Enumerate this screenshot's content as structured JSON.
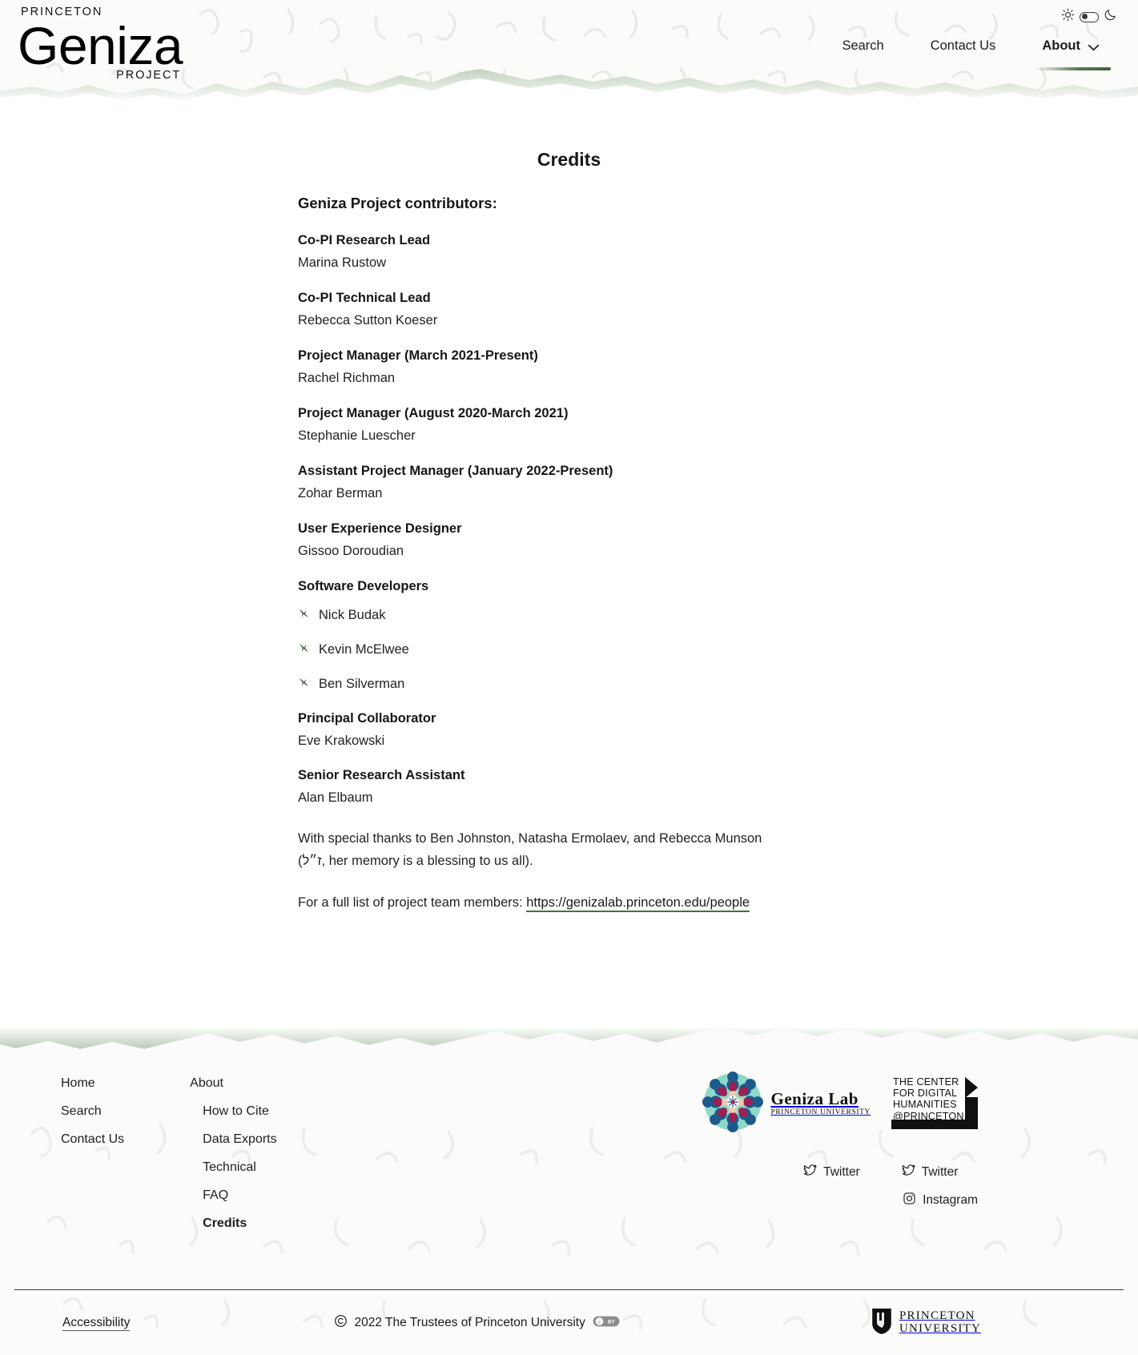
{
  "header": {
    "brand": {
      "princeton": "PRINCETON",
      "geniza": "Geniza",
      "project": "PROJECT"
    },
    "theme": {
      "sun_icon": "sun-icon",
      "moon_icon": "moon-icon",
      "switch_icon": "theme-toggle-switch"
    },
    "nav": [
      {
        "label": "Search",
        "active": false
      },
      {
        "label": "Contact Us",
        "active": false
      },
      {
        "label": "About",
        "active": true,
        "has_chevron": true
      }
    ]
  },
  "main": {
    "page_title": "Credits",
    "section_heading": "Geniza Project contributors:",
    "credits": [
      {
        "role": "Co-PI Research Lead",
        "name": "Marina Rustow"
      },
      {
        "role": "Co-PI Technical Lead",
        "name": "Rebecca Sutton Koeser"
      },
      {
        "role": "Project Manager (March 2021-Present)",
        "name": "Rachel Richman"
      },
      {
        "role": "Project Manager (August 2020-March 2021)",
        "name": "Stephanie Luescher"
      },
      {
        "role": "Assistant Project Manager (January 2022-Present)",
        "name": "Zohar Berman"
      },
      {
        "role": "User Experience Designer",
        "name": "Gissoo Doroudian"
      }
    ],
    "developers_heading": "Software Developers",
    "developers": [
      "Nick Budak",
      "Kevin McElwee",
      "Ben Silverman"
    ],
    "credits_after": [
      {
        "role": "Principal Collaborator",
        "name": "Eve Krakowski"
      },
      {
        "role": "Senior Research Assistant",
        "name": "Alan Elbaum"
      }
    ],
    "thanks_paragraph": "With special thanks to Ben Johnston, Natasha Ermolaev, and Rebecca Munson (ז״ל, her memory is a blessing to us all).",
    "full_list_prefix": "For a full list of project team members: ",
    "full_list_link": "https://genizalab.princeton.edu/people"
  },
  "footer": {
    "nav_col1": [
      {
        "label": "Home",
        "sub": false,
        "current": false
      },
      {
        "label": "Search",
        "sub": false,
        "current": false
      },
      {
        "label": "Contact Us",
        "sub": false,
        "current": false
      }
    ],
    "nav_col2": [
      {
        "label": "About",
        "sub": false,
        "current": false
      },
      {
        "label": "How to Cite",
        "sub": true,
        "current": false
      },
      {
        "label": "Data Exports",
        "sub": true,
        "current": false
      },
      {
        "label": "Technical",
        "sub": true,
        "current": false
      },
      {
        "label": "FAQ",
        "sub": true,
        "current": false
      },
      {
        "label": "Credits",
        "sub": true,
        "current": true
      }
    ],
    "geniza_lab": {
      "name": "Geniza Lab",
      "sub": "PRINCETON UNIVERSITY",
      "logo_icon": "geniza-lab-mandala-logo"
    },
    "cdh": {
      "line1": "THE CENTER",
      "line2": "FOR DIGITAL",
      "line3": "HUMANITIES",
      "line4": "@PRINCETON"
    },
    "social": [
      {
        "label": "Twitter",
        "icon": "twitter-icon"
      },
      {
        "label": "Twitter",
        "icon": "twitter-icon"
      },
      {
        "label": "Instagram",
        "icon": "instagram-icon"
      }
    ],
    "accessibility": "Accessibility",
    "copyright": "2022 The Trustees of Princeton University",
    "copyright_icon": "copyright-icon",
    "cc_badge": "cc-by-icon",
    "princeton": {
      "line1": "PRINCETON",
      "line2": "UNIVERSITY",
      "shield_icon": "princeton-shield-icon"
    }
  },
  "colors": {
    "accent_green": "#4e6b4a",
    "paper": "#fbfbfa",
    "text": "#1a1a1a"
  }
}
